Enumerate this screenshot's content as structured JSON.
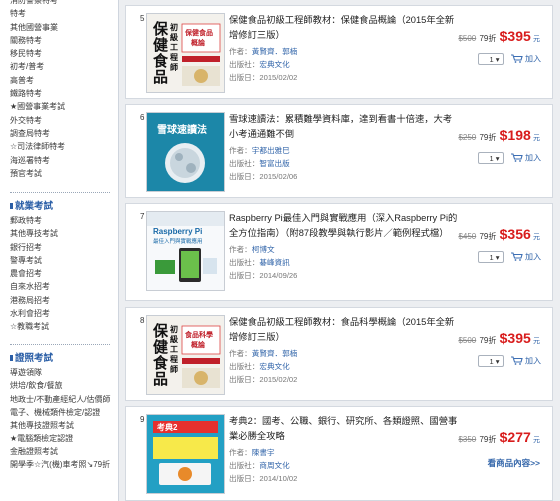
{
  "sidebar": {
    "group1": [
      "消防警察特考",
      "特考",
      "其他國營事業",
      "關務特考",
      "移民特考",
      "初考/普考",
      "高普考",
      "鐵路特考",
      "★國營事業考試",
      "外交特考",
      "調查局特考",
      "☆司法律師特考",
      "海巡署特考",
      "預官考試"
    ],
    "group2_title": "就業考試",
    "group2": [
      "郵政特考",
      "其他專技考試",
      "銀行招考",
      "警專考試",
      "農會招考",
      "自來水招考",
      "港務局招考",
      "水利會招考",
      "☆教職考試"
    ],
    "group3_title": "證照考試",
    "group3": [
      "導遊領隊",
      "烘培/飲食/餐旅",
      "地政士/不動產經紀人/估價師",
      "電子、機械類件檢定/認證",
      "其他專技證照考試",
      "★電腦類檢定認證",
      "金融證照考試",
      "開學季☆汽(機)車考照↘79折"
    ]
  },
  "labels": {
    "author": "作者：",
    "publisher": "出版社：",
    "date": "出版日：",
    "discount": "79折",
    "currency": "$",
    "unit_label": "元",
    "add": "加入",
    "qty": "1",
    "more": "看商品內容>>"
  },
  "products": [
    {
      "rank": "5",
      "title": "保健食品初級工程師教材：保健食品概論（2015年全新增修訂三版）",
      "author": "黃賢齊．郭楠",
      "publisher": "宏典文化",
      "date": "2015/02/02",
      "old_price": "$500",
      "price": "395",
      "cover": {
        "bg": "#f3f1ec",
        "main": "保健食品初級工程師",
        "sub": "保健食品概論"
      }
    },
    {
      "rank": "6",
      "title": "雪球速讀法：累積難學資料庫，達到看書十倍速，大考小考通通難不倒",
      "author": "宇都出雅巳",
      "publisher": "智富出版",
      "date": "2015/02/06",
      "old_price": "$250",
      "price": "198",
      "cover": {
        "bg": "#1f8fb0",
        "main": "雪球速讀法",
        "sub": ""
      }
    },
    {
      "rank": "7",
      "title": "Raspberry Pi最佳入門與實戰應用（深入Raspberry Pi的全方位指南）（附87段教學與執行影片／範例程式檔）",
      "author": "柯博文",
      "publisher": "碁峰資訊",
      "date": "2014/09/26",
      "old_price": "$450",
      "price": "356",
      "cover": {
        "bg": "#f7f9fb",
        "main": "Raspberry Pi",
        "sub": "最佳入門與實戰應用"
      }
    },
    {
      "rank": "8",
      "title": "保健食品初級工程師教材：食品科學概論（2015年全新增修訂三版）",
      "author": "黃賢齊．郭楠",
      "publisher": "宏典文化",
      "date": "2015/02/02",
      "old_price": "$500",
      "price": "395",
      "cover": {
        "bg": "#f3f1ec",
        "main": "保健食品初級工程師",
        "sub": "食品科學概論"
      }
    },
    {
      "rank": "9",
      "title": "考典2：國考、公職、銀行、研究所、各類證照、國營事業必勝全攻略",
      "author": "陳書宇",
      "publisher": "商周文化",
      "date": "2014/10/02",
      "old_price": "$350",
      "price": "277",
      "cover": {
        "bg": "#2aa6c8",
        "main": "考典2",
        "sub": ""
      }
    }
  ]
}
